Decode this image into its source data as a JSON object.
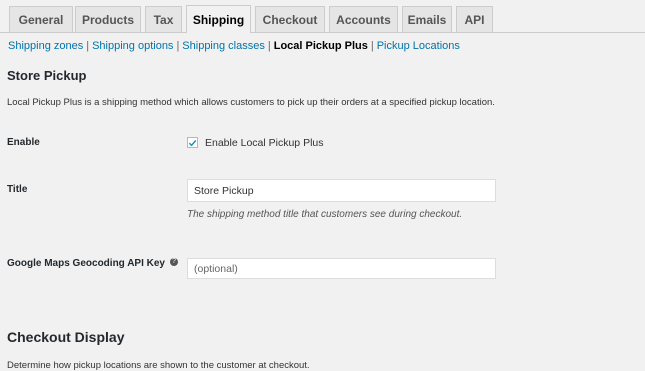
{
  "tabs": [
    {
      "label": "General"
    },
    {
      "label": "Products"
    },
    {
      "label": "Tax"
    },
    {
      "label": "Shipping"
    },
    {
      "label": "Checkout"
    },
    {
      "label": "Accounts"
    },
    {
      "label": "Emails"
    },
    {
      "label": "API"
    }
  ],
  "subnav": {
    "shipping_zones": "Shipping zones",
    "shipping_options": "Shipping options",
    "shipping_classes": "Shipping classes",
    "local_pickup_plus": "Local Pickup Plus",
    "pickup_locations": "Pickup Locations",
    "separator": "|"
  },
  "store_pickup": {
    "heading": "Store Pickup",
    "description": "Local Pickup Plus is a shipping method which allows customers to pick up their orders at a specified pickup location.",
    "enable_label": "Enable",
    "enable_checkbox_label": "Enable Local Pickup Plus",
    "enable_checked": true,
    "title_label": "Title",
    "title_value": "Store Pickup",
    "title_hint": "The shipping method title that customers see during checkout.",
    "gmaps_label": "Google Maps Geocoding API Key",
    "gmaps_placeholder": "(optional)"
  },
  "checkout_display": {
    "heading": "Checkout Display",
    "description": "Determine how pickup locations are shown to the customer at checkout."
  },
  "colors": {
    "link": "#0073aa",
    "background": "#f1f1f1",
    "tab_inactive": "#e5e5e5"
  }
}
